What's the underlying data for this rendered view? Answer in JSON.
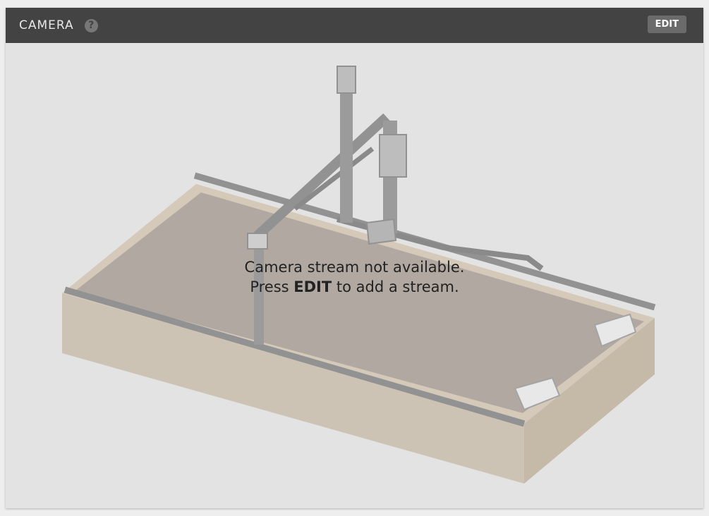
{
  "header": {
    "title": "CAMERA",
    "help_icon": "question-circle-icon",
    "edit_label": "EDIT"
  },
  "message": {
    "line1": "Camera stream not available.",
    "line2_prefix": "Press",
    "line2_strong": "EDIT",
    "line2_suffix": "to add a stream."
  },
  "illustration": {
    "subject": "farmbot-gantry-on-raised-bed"
  },
  "colors": {
    "header_bg": "#434343",
    "body_bg": "#e3e3e3",
    "edit_button_bg": "#6b6b6b",
    "bed_wood": "#b89f80",
    "soil": "#8a7b6c"
  }
}
